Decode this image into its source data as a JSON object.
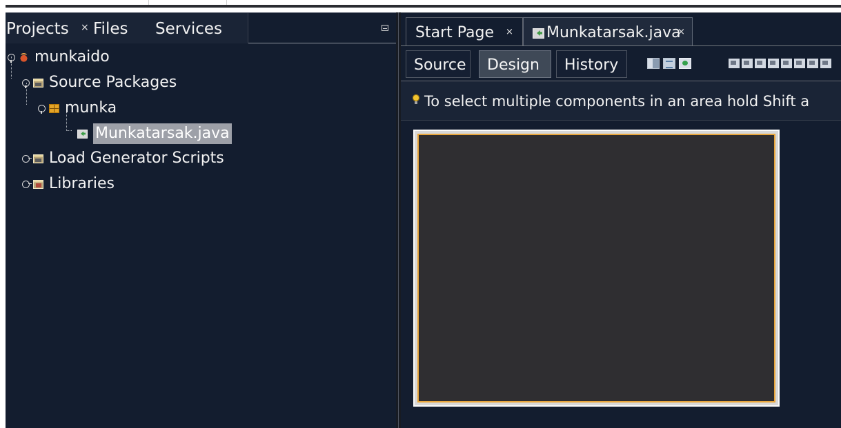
{
  "projects_panel": {
    "tabs": [
      {
        "label": "Projects",
        "close": "×"
      },
      {
        "label": "Files"
      },
      {
        "label": "Services"
      }
    ],
    "tree": [
      {
        "label": "munkaido",
        "icon": "project-icon"
      },
      {
        "label": "Source Packages",
        "icon": "source-packages-icon"
      },
      {
        "label": "munka",
        "icon": "package-icon"
      },
      {
        "label": "Munkatarsak.java",
        "icon": "java-form-icon",
        "selected": true
      },
      {
        "label": "Load Generator Scripts",
        "icon": "scripts-folder-icon"
      },
      {
        "label": "Libraries",
        "icon": "libraries-icon"
      }
    ]
  },
  "editor": {
    "tabs": [
      {
        "label": "Start Page",
        "close": "×"
      },
      {
        "label": "Munkatarsak.java",
        "close": "×",
        "active": true
      }
    ],
    "views": [
      {
        "label": "Source"
      },
      {
        "label": "Design",
        "active": true
      },
      {
        "label": "History"
      }
    ],
    "hint": "To select multiple components in an area hold Shift a",
    "colors": {
      "background": "#131d2f",
      "selection_outline": "#e9a63c",
      "form_canvas": "#2f2e31"
    }
  }
}
